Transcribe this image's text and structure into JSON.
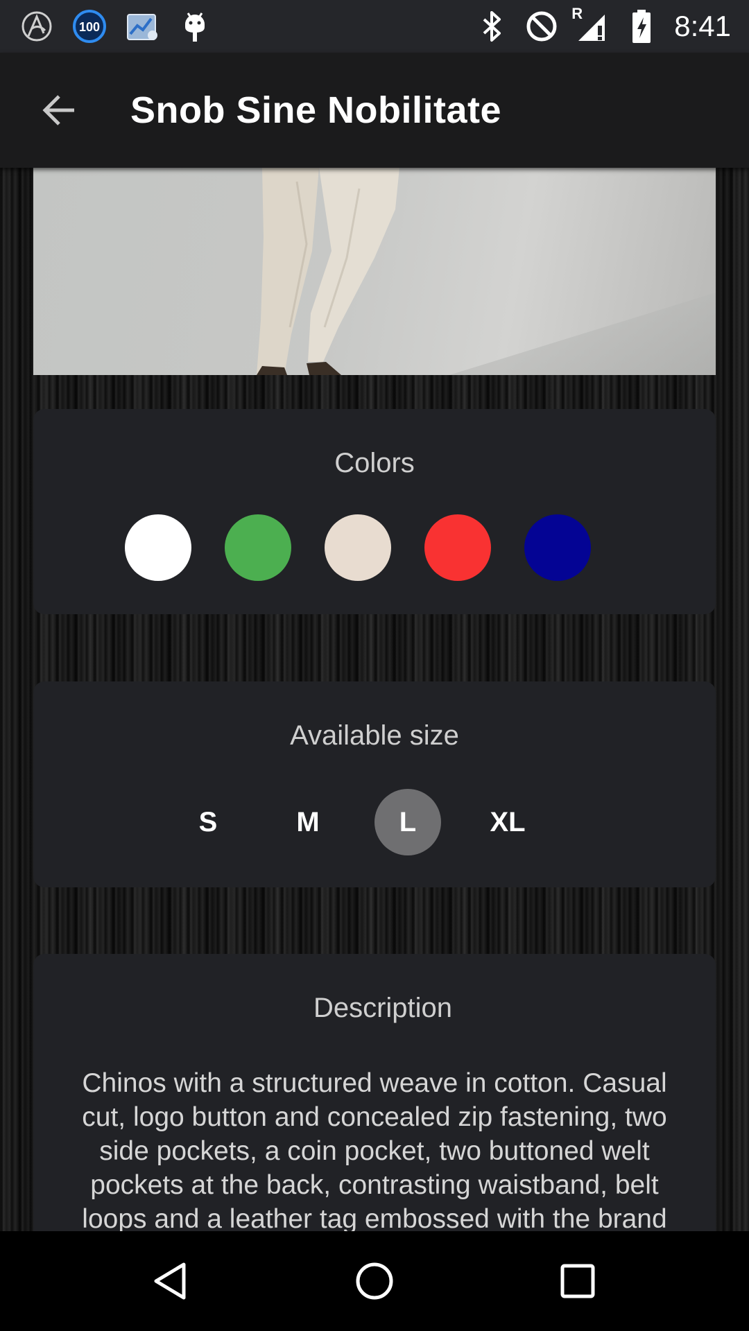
{
  "status_bar": {
    "time": "8:41",
    "notification_badge": "100",
    "left_icons": [
      "arc-logo-icon",
      "badge-100-icon",
      "image-chart-icon",
      "android-debug-icon"
    ],
    "right_icons": [
      "bluetooth-icon",
      "do-not-disturb-icon",
      "signal-roaming-icon",
      "battery-charging-icon"
    ],
    "roaming_mark": "R"
  },
  "app_bar": {
    "title": "Snob Sine Nobilitate",
    "back_icon": "arrow-back-icon"
  },
  "colors_panel": {
    "title": "Colors",
    "swatches": [
      {
        "name": "white",
        "color": "#ffffff"
      },
      {
        "name": "green",
        "color": "#4caf50"
      },
      {
        "name": "beige",
        "color": "#e8dcd0"
      },
      {
        "name": "red",
        "color": "#f93232"
      },
      {
        "name": "navy",
        "color": "#040494"
      }
    ]
  },
  "size_panel": {
    "title": "Available size",
    "sizes": [
      "S",
      "M",
      "L",
      "XL"
    ],
    "selected": "L"
  },
  "description_panel": {
    "title": "Description",
    "text": "Chinos with a structured weave in cotton. Casual cut, logo button and concealed zip fastening, two side pockets, a coin pocket, two buttoned welt pockets at the back, contrasting waistband, belt loops and a leather tag embossed with the brand"
  },
  "nav_bar": {
    "icons": [
      "back-triangle-icon",
      "home-circle-icon",
      "recents-square-icon"
    ]
  }
}
